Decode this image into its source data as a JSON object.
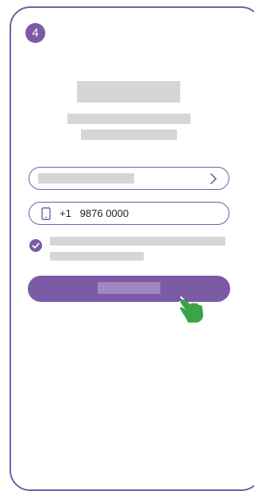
{
  "step": {
    "number": "4"
  },
  "phone_field": {
    "country_code": "+1",
    "number": "9876 0000"
  },
  "consent": {
    "checked": true
  },
  "icons": {
    "step_badge": "step-number-badge",
    "chevron": "chevron-right-icon",
    "phone": "smartphone-icon",
    "check": "check-circle-icon",
    "hand": "tapping-hand-icon"
  },
  "colors": {
    "accent": "#7b5aa6",
    "placeholder": "#d6d6d6",
    "hand": "#3aa545"
  }
}
